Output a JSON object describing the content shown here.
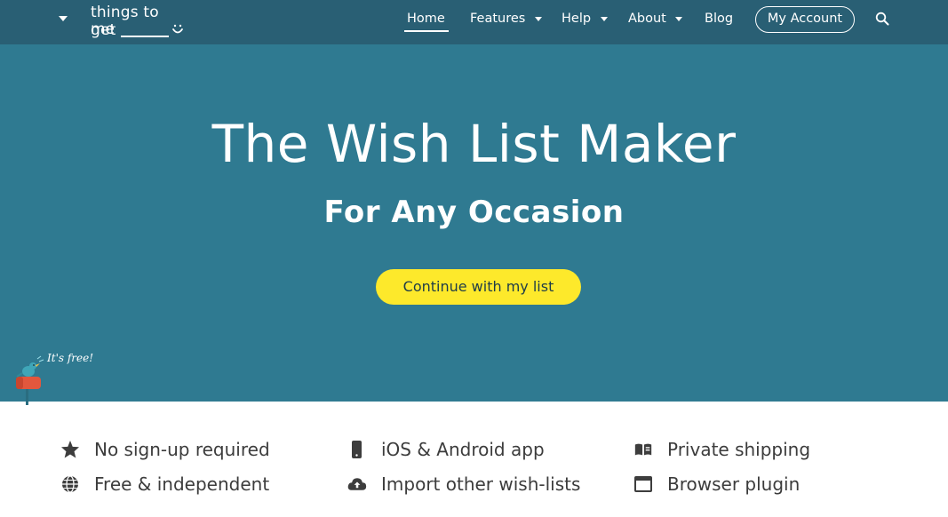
{
  "colors": {
    "nav_bg": "#295f74",
    "hero_bg": "#2f7a91",
    "cta_bg": "#fde92b",
    "text_light": "#ffffff",
    "text_dark": "#3c3c3c"
  },
  "logo": {
    "line1": "things to get",
    "line2": "me",
    "icon": "smile-icon"
  },
  "nav": {
    "home": "Home",
    "features": "Features",
    "help": "Help",
    "about": "About",
    "blog": "Blog",
    "account": "My Account",
    "search_icon": "search-icon",
    "menu_caret_icon": "caret-down-icon"
  },
  "hero": {
    "title": "The Wish List Maker",
    "subtitle": "For Any Occasion",
    "cta": "Continue with my list",
    "note": "It's free!"
  },
  "features": [
    {
      "label": "No sign-up required",
      "icon": "star-icon"
    },
    {
      "label": "iOS & Android app",
      "icon": "mobile-phone-icon"
    },
    {
      "label": "Private shipping",
      "icon": "address-card-icon"
    },
    {
      "label": "Free & independent",
      "icon": "globe-icon"
    },
    {
      "label": "Import other wish-lists",
      "icon": "cloud-upload-icon"
    },
    {
      "label": "Browser plugin",
      "icon": "browser-window-icon"
    }
  ]
}
